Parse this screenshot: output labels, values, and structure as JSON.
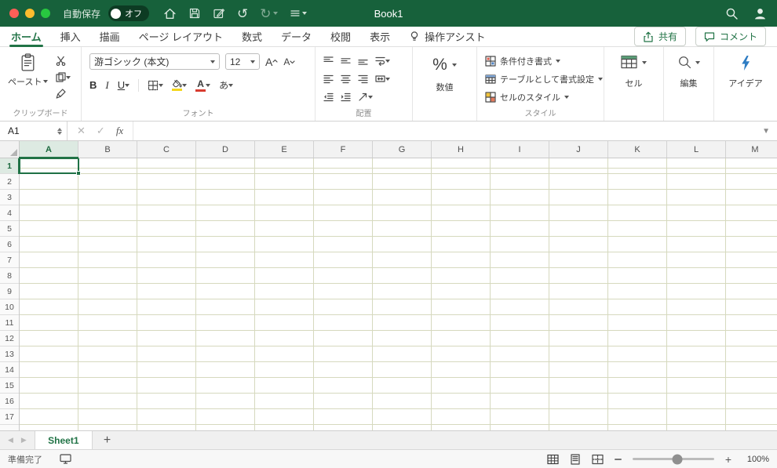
{
  "accent": "#217346",
  "grid_line_color": "#d6d9be",
  "titlebar": {
    "autosave_label": "自動保存",
    "autosave_state": "オフ",
    "title": "Book1"
  },
  "tabs": [
    "ホーム",
    "挿入",
    "描画",
    "ページ レイアウト",
    "数式",
    "データ",
    "校閲",
    "表示"
  ],
  "active_tab": "ホーム",
  "tellme": "操作アシスト",
  "actions": {
    "share": "共有",
    "comments": "コメント"
  },
  "ribbon": {
    "clipboard": {
      "label": "クリップボード",
      "paste": "ペースト"
    },
    "font": {
      "label": "フォント",
      "font_name": "游ゴシック (本文)",
      "font_size": "12",
      "bold": "B",
      "italic": "I",
      "underline": "U",
      "color_letter": "A",
      "grow_letter": "A",
      "shrink_letter": "A",
      "phonetic_letter": "あ"
    },
    "alignment": {
      "label": "配置"
    },
    "number": {
      "label": "数値",
      "percent": "%"
    },
    "styles": {
      "label": "スタイル",
      "buttons": [
        "条件付き書式",
        "テーブルとして書式設定",
        "セルのスタイル"
      ]
    },
    "cells": {
      "label": "セル"
    },
    "editing": {
      "label": "編集"
    },
    "ideas": {
      "label": "アイデア"
    }
  },
  "formula_bar": {
    "name_box": "A1",
    "cancel": "✕",
    "enter": "✓",
    "fx": "fx"
  },
  "grid": {
    "columns": [
      "A",
      "B",
      "C",
      "D",
      "E",
      "F",
      "G",
      "H",
      "I",
      "J",
      "K",
      "L",
      "M"
    ],
    "rows": [
      "1",
      "2",
      "3",
      "4",
      "5",
      "6",
      "7",
      "8",
      "9",
      "10",
      "11",
      "12",
      "13",
      "14",
      "15",
      "16",
      "17"
    ],
    "selected_cell": "A1",
    "selected_col": "A",
    "selected_row": "1"
  },
  "sheet_tabs": {
    "active": "Sheet1"
  },
  "status_bar": {
    "ready": "準備完了",
    "zoom": "100%"
  }
}
